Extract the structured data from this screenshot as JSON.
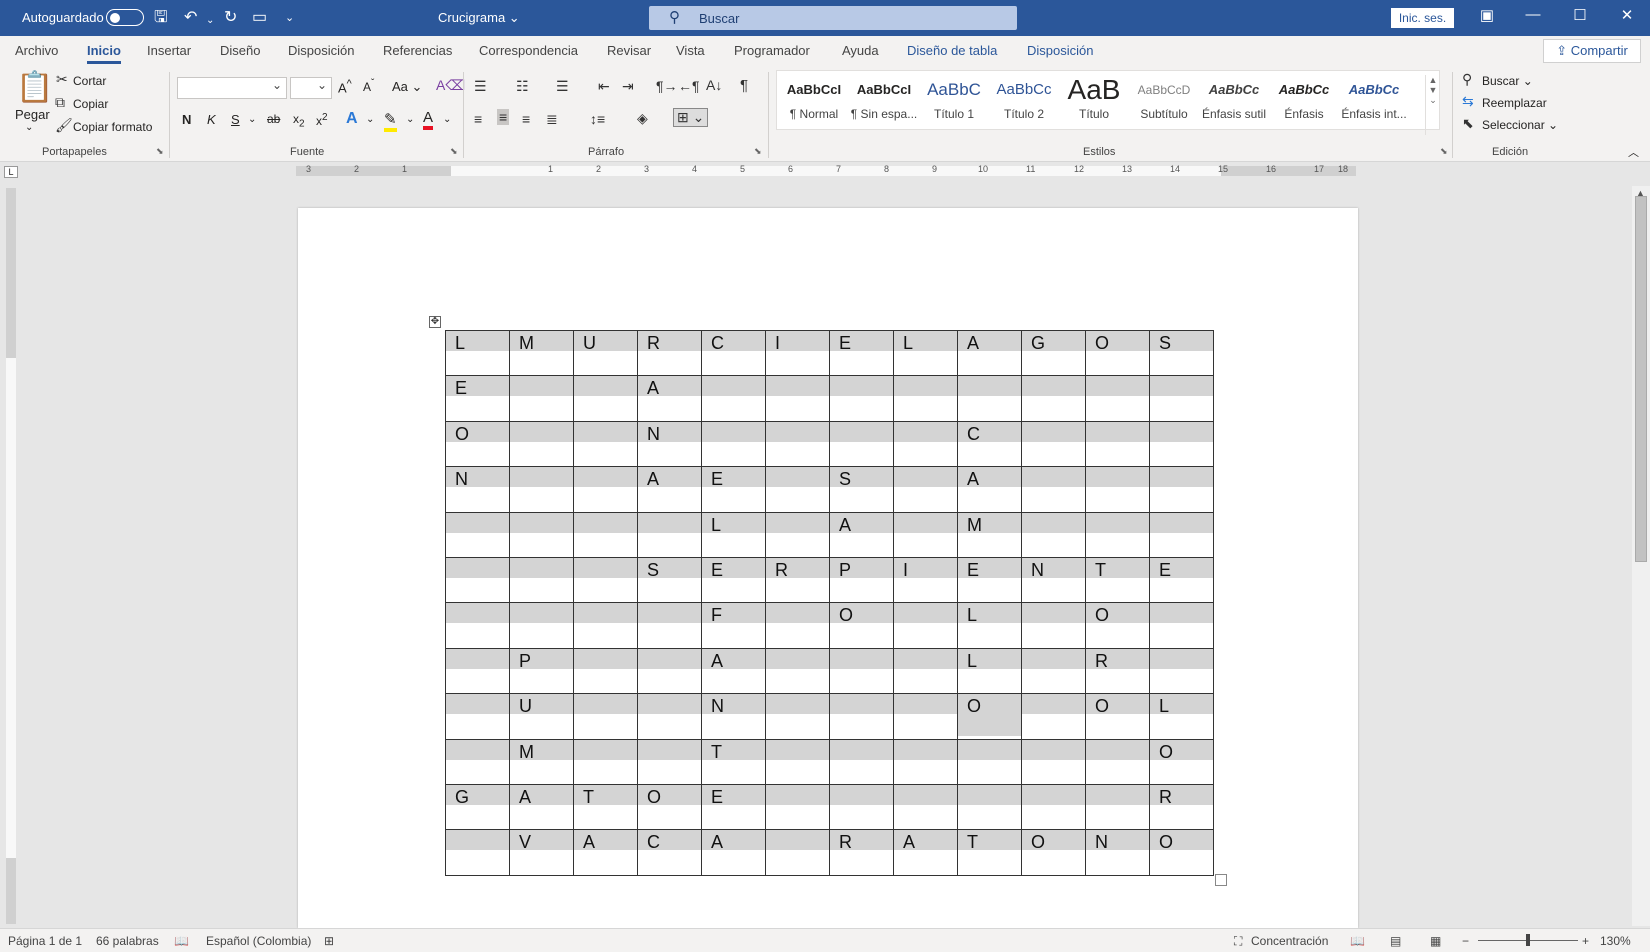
{
  "titlebar": {
    "autosave_label": "Autoguardado",
    "doc_title": "Crucigrama",
    "search_placeholder": "Buscar",
    "signin_label": "Inic. ses."
  },
  "menu": {
    "tabs": [
      "Archivo",
      "Inicio",
      "Insertar",
      "Diseño",
      "Disposición",
      "Referencias",
      "Correspondencia",
      "Revisar",
      "Vista",
      "Programador",
      "Ayuda",
      "Diseño de tabla",
      "Disposición"
    ],
    "active": "Inicio",
    "share_label": "Compartir"
  },
  "ribbon": {
    "clipboard": {
      "paste": "Pegar",
      "cut": "Cortar",
      "copy": "Copiar",
      "format_painter": "Copiar formato",
      "label": "Portapapeles"
    },
    "font": {
      "label": "Fuente",
      "bold": "N",
      "italic": "K",
      "underline": "S",
      "case": "Aa"
    },
    "paragraph": {
      "label": "Párrafo"
    },
    "styles": {
      "label": "Estilos",
      "items": [
        {
          "sample": "AaBbCcI",
          "name": "¶ Normal"
        },
        {
          "sample": "AaBbCcI",
          "name": "¶ Sin espa..."
        },
        {
          "sample": "AaBbC",
          "name": "Título 1"
        },
        {
          "sample": "AaBbCc",
          "name": "Título 2"
        },
        {
          "sample": "AaB",
          "name": "Título"
        },
        {
          "sample": "AaBbCcD",
          "name": "Subtítulo"
        },
        {
          "sample": "AaBbCc",
          "name": "Énfasis sutil"
        },
        {
          "sample": "AaBbCc",
          "name": "Énfasis"
        },
        {
          "sample": "AaBbCc",
          "name": "Énfasis int..."
        }
      ]
    },
    "editing": {
      "label": "Edición",
      "find": "Buscar",
      "replace": "Reemplazar",
      "select": "Seleccionar"
    }
  },
  "ruler": {
    "h_numbers": [
      "3",
      "2",
      "1",
      "1",
      "2",
      "3",
      "4",
      "5",
      "6",
      "7",
      "8",
      "9",
      "10",
      "11",
      "12",
      "13",
      "14",
      "15",
      "16",
      "17",
      "18"
    ],
    "corner": "L"
  },
  "crossword": [
    [
      "L",
      "M",
      "U",
      "R",
      "C",
      "I",
      "E",
      "L",
      "A",
      "G",
      "O",
      "S"
    ],
    [
      "E",
      "",
      "",
      "A",
      "",
      "",
      "",
      "",
      "",
      "",
      "",
      ""
    ],
    [
      "O",
      "",
      "",
      "N",
      "",
      "",
      "",
      "",
      "C",
      "",
      "",
      ""
    ],
    [
      "N",
      "",
      "",
      "A",
      "E",
      "",
      "S",
      "",
      "A",
      "",
      "",
      ""
    ],
    [
      "",
      "",
      "",
      "",
      "L",
      "",
      "A",
      "",
      "M",
      "",
      "",
      ""
    ],
    [
      "",
      "",
      "",
      "S",
      "E",
      "R",
      "P",
      "I",
      "E",
      "N",
      "T",
      "E"
    ],
    [
      "",
      "",
      "",
      "",
      "F",
      "",
      "O",
      "",
      "L",
      "",
      "O",
      ""
    ],
    [
      "",
      "P",
      "",
      "",
      "A",
      "",
      "",
      "",
      "L",
      "",
      "R",
      ""
    ],
    [
      "",
      "U",
      "",
      "",
      "N",
      "",
      "",
      "",
      "O",
      "",
      "O",
      "L"
    ],
    [
      "",
      "M",
      "",
      "",
      "T",
      "",
      "",
      "",
      "",
      "",
      "",
      "O"
    ],
    [
      "G",
      "A",
      "T",
      "O",
      "E",
      "",
      "",
      "",
      "",
      "",
      "",
      "R"
    ],
    [
      "",
      "V",
      "A",
      "C",
      "A",
      "",
      "R",
      "A",
      "T",
      "O",
      "N",
      "O"
    ]
  ],
  "status": {
    "page": "Página 1 de 1",
    "words": "66 palabras",
    "language": "Español (Colombia)",
    "focus": "Concentración",
    "zoom": "130%"
  }
}
